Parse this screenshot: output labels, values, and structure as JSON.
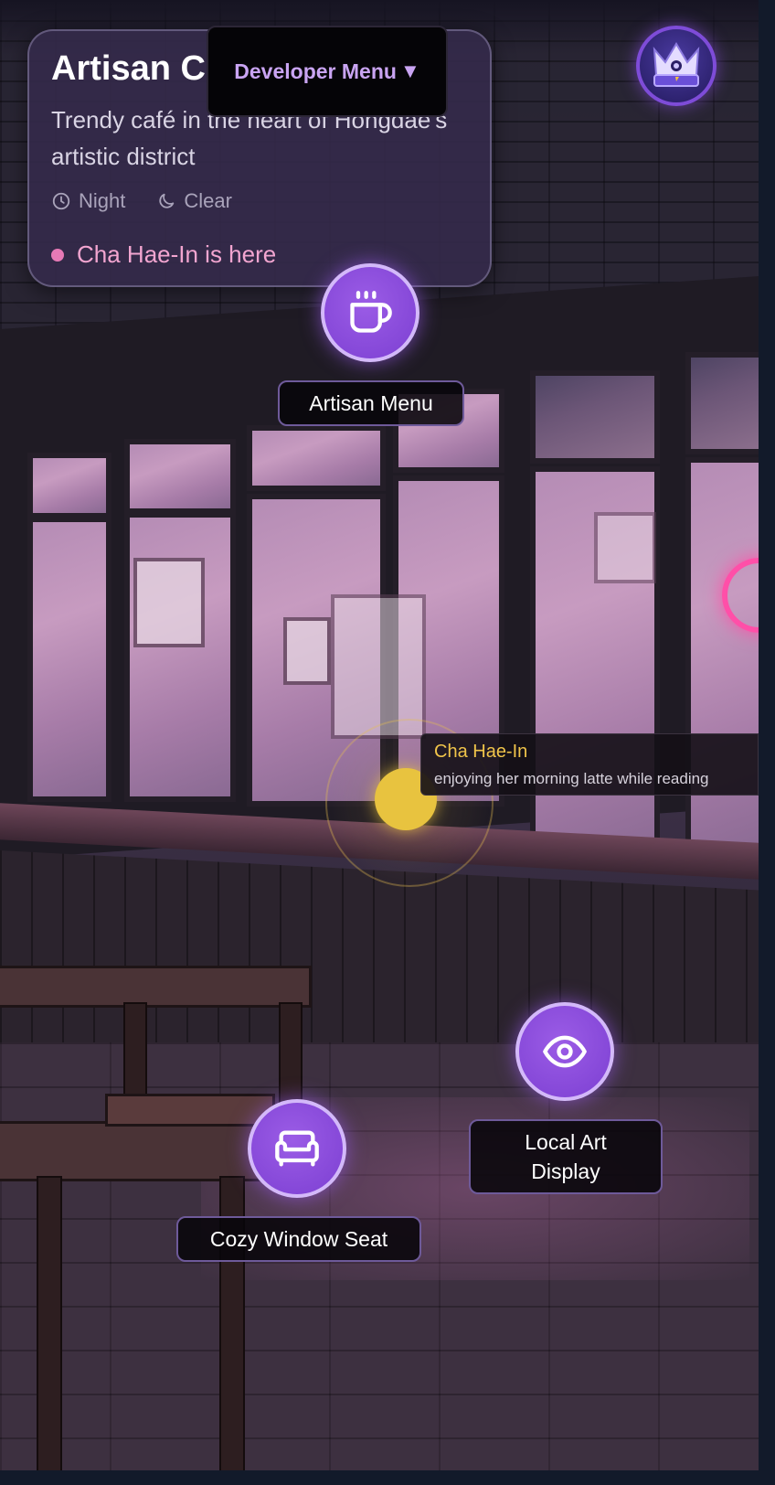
{
  "location": {
    "title": "Artisan C",
    "description": "Trendy café in the heart of Hongdae's artistic district",
    "time_of_day": "Night",
    "weather": "Clear",
    "presence": "Cha Hae-In is here"
  },
  "dev_menu": {
    "label": "Developer Menu",
    "arrow": "▼"
  },
  "profile": {
    "icon": "crown-icon"
  },
  "hotspots": [
    {
      "label": "Artisan Menu",
      "icon": "coffee-cup-icon"
    },
    {
      "label": "Local Art Display",
      "icon": "eye-icon"
    },
    {
      "label": "Cozy Window Seat",
      "icon": "sofa-icon"
    }
  ],
  "character": {
    "name": "Cha Hae-In",
    "activity": "enjoying her morning latte while reading"
  },
  "colors": {
    "accent": "#8b4fdc",
    "presence": "#e779b6",
    "character": "#e8c33f",
    "dev_menu_text": "#c9a4f2"
  }
}
